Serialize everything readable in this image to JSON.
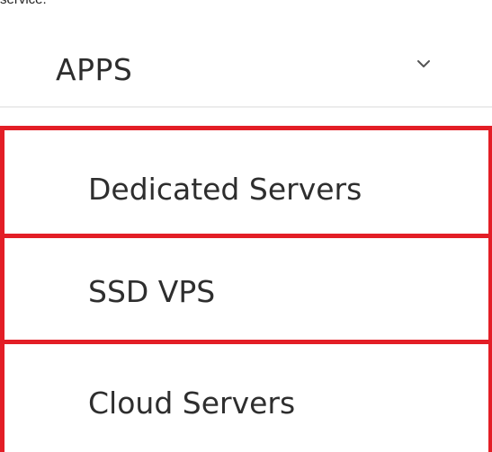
{
  "fragment_text": "service.",
  "menu": {
    "header_label": "APPS",
    "items": [
      {
        "label": "Dedicated Servers"
      },
      {
        "label": "SSD VPS"
      },
      {
        "label": "Cloud Servers"
      }
    ]
  },
  "colors": {
    "highlight_border": "#e31e26",
    "text": "#2e2e2e",
    "background": "#ffffff"
  },
  "icons": {
    "header_chevron": "chevron-down-icon"
  }
}
